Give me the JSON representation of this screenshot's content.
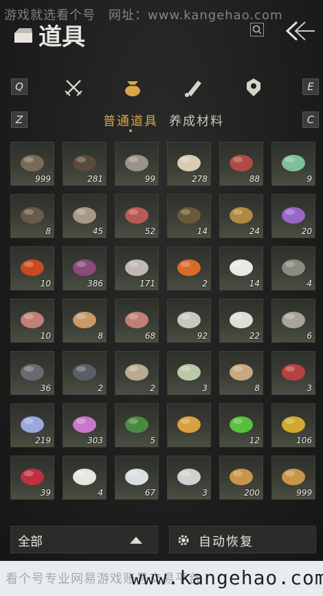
{
  "watermark_top": "游戏就选看个号　网址：www.kangehao.com",
  "header": {
    "title": "道具",
    "search_icon": "search-icon",
    "back_icon": "back-icon"
  },
  "tabs": {
    "left_key": "Q",
    "right_key": "E",
    "items": [
      {
        "icon": "crossed-swords-icon",
        "active": false
      },
      {
        "icon": "pouch-icon",
        "active": true
      },
      {
        "icon": "scroll-icon",
        "active": false
      },
      {
        "icon": "badge-icon",
        "active": false
      }
    ]
  },
  "subtabs": {
    "left_key": "Z",
    "right_key": "C",
    "items": [
      {
        "label": "普通道具",
        "active": true
      },
      {
        "label": "养成材料",
        "active": false
      }
    ]
  },
  "accent_color": "#d8a64a",
  "items": [
    {
      "icon": "wood-logs-icon",
      "count": "999"
    },
    {
      "icon": "dark-feather-icon",
      "count": "281"
    },
    {
      "icon": "fish-icon",
      "count": "99"
    },
    {
      "icon": "eggs-icon",
      "count": "278"
    },
    {
      "icon": "raw-meat-icon",
      "count": "88"
    },
    {
      "icon": "jade-stone-icon",
      "count": "9"
    },
    {
      "icon": "feathers-bundle-icon",
      "count": "8"
    },
    {
      "icon": "hide-icon",
      "count": "45"
    },
    {
      "icon": "meat-slab-icon",
      "count": "52"
    },
    {
      "icon": "dried-fish-icon",
      "count": "14"
    },
    {
      "icon": "gold-ore-icon",
      "count": "24"
    },
    {
      "icon": "amethyst-icon",
      "count": "20"
    },
    {
      "icon": "red-stone-icon",
      "count": "10"
    },
    {
      "icon": "purple-flower-icon",
      "count": "386"
    },
    {
      "icon": "herb-sprig-icon",
      "count": "171"
    },
    {
      "icon": "orange-flower-icon",
      "count": "2"
    },
    {
      "icon": "white-feather-icon",
      "count": "14"
    },
    {
      "icon": "grass-icon",
      "count": "4"
    },
    {
      "icon": "meat-cuts-icon",
      "count": "10"
    },
    {
      "icon": "bowl-icon",
      "count": "8"
    },
    {
      "icon": "meat-cuts-icon",
      "count": "68"
    },
    {
      "icon": "needles-icon",
      "count": "92"
    },
    {
      "icon": "wool-icon",
      "count": "22"
    },
    {
      "icon": "small-fish-icon",
      "count": "6"
    },
    {
      "icon": "coal-icon",
      "count": "36"
    },
    {
      "icon": "iron-ore-icon",
      "count": "2"
    },
    {
      "icon": "bone-icon",
      "count": "2"
    },
    {
      "icon": "melon-icon",
      "count": "3"
    },
    {
      "icon": "sacks-icon",
      "count": "8"
    },
    {
      "icon": "red-berries-icon",
      "count": "3"
    },
    {
      "icon": "blue-flower-icon",
      "count": "219"
    },
    {
      "icon": "pink-flower-icon",
      "count": "303"
    },
    {
      "icon": "green-herb-icon",
      "count": "5"
    },
    {
      "icon": "sparkle-staff-icon",
      "count": ""
    },
    {
      "icon": "green-orb-icon",
      "count": "12"
    },
    {
      "icon": "gold-toad-icon",
      "count": "106"
    },
    {
      "icon": "red-crystal-icon",
      "count": "39"
    },
    {
      "icon": "white-flower-icon",
      "count": "4"
    },
    {
      "icon": "jar-icon",
      "count": "67"
    },
    {
      "icon": "fur-tail-icon",
      "count": "3"
    },
    {
      "icon": "turtle-shell-icon",
      "count": "200"
    },
    {
      "icon": "turtle-shell-icon",
      "count": "999"
    }
  ],
  "bottom": {
    "filter_label": "全部",
    "auto_label": "自动恢复",
    "gear_icon": "gear-icon"
  },
  "footer": {
    "text": "看个号专业网易游戏账号交易平台",
    "site": "www.kangehao.com"
  }
}
